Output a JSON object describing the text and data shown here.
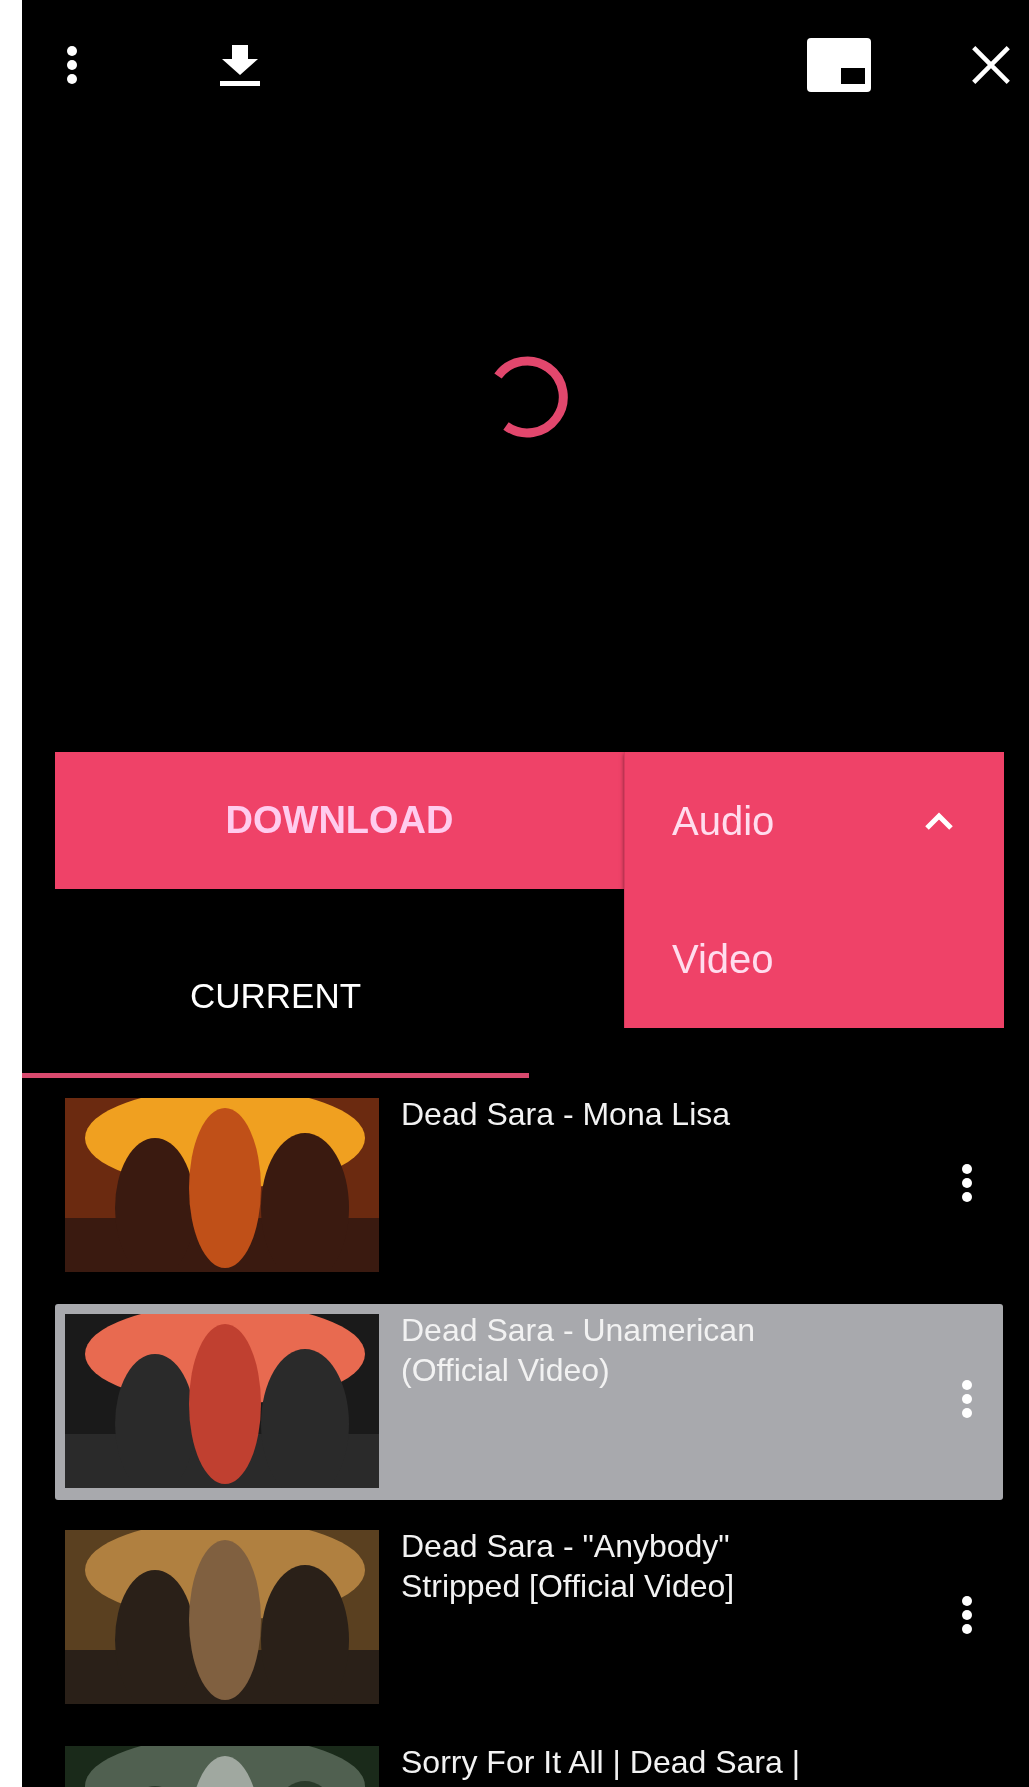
{
  "download_bar": {
    "button": "DOWNLOAD",
    "format_menu": {
      "expanded": true,
      "options": [
        {
          "label": "Audio"
        },
        {
          "label": "Video"
        }
      ]
    }
  },
  "tabs": [
    {
      "label": "CURRENT",
      "selected": true
    }
  ],
  "playlist": [
    {
      "title": "Dead Sara - Mona Lisa",
      "selected": false
    },
    {
      "title": "Dead Sara - Unamerican (Official Video)",
      "selected": true
    },
    {
      "title": "Dead Sara - \"Anybody\" Stripped [Official Video]",
      "selected": false
    },
    {
      "title": "Sorry For It All | Dead Sara |",
      "selected": false
    }
  ]
}
